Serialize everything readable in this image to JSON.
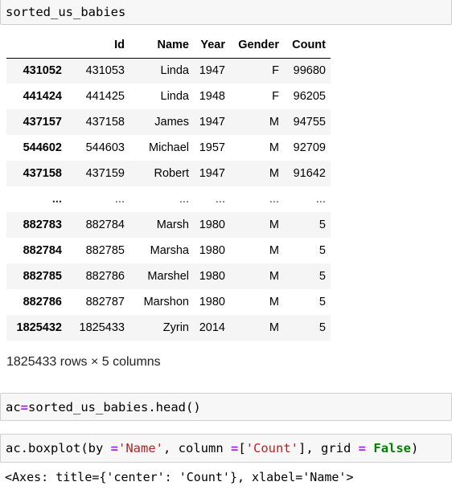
{
  "cells": {
    "cell1_code": "sorted_us_babies",
    "cell2": {
      "var": "ac",
      "op": "=",
      "rest": "sorted_us_babies.head()"
    },
    "cell3": {
      "p1": "ac.boxplot(by ",
      "eq1": "=",
      "s1": "'Name'",
      "p2": ", column ",
      "eq2": "=",
      "p3": "[",
      "s2": "'Count'",
      "p4": "], grid ",
      "eq3": "=",
      "p5": " ",
      "kw": "False",
      "p6": ")"
    },
    "output_repr": "<Axes: title={'center': 'Count'}, xlabel='Name'>"
  },
  "dataframe": {
    "columns": [
      "Id",
      "Name",
      "Year",
      "Gender",
      "Count"
    ],
    "rows": [
      {
        "index": "431052",
        "cells": [
          "431053",
          "Linda",
          "1947",
          "F",
          "99680"
        ]
      },
      {
        "index": "441424",
        "cells": [
          "441425",
          "Linda",
          "1948",
          "F",
          "96205"
        ]
      },
      {
        "index": "437157",
        "cells": [
          "437158",
          "James",
          "1947",
          "M",
          "94755"
        ]
      },
      {
        "index": "544602",
        "cells": [
          "544603",
          "Michael",
          "1957",
          "M",
          "92709"
        ]
      },
      {
        "index": "437158",
        "cells": [
          "437159",
          "Robert",
          "1947",
          "M",
          "91642"
        ]
      },
      {
        "index": "...",
        "cells": [
          "...",
          "...",
          "...",
          "...",
          "..."
        ]
      },
      {
        "index": "882783",
        "cells": [
          "882784",
          "Marsh",
          "1980",
          "M",
          "5"
        ]
      },
      {
        "index": "882784",
        "cells": [
          "882785",
          "Marsha",
          "1980",
          "M",
          "5"
        ]
      },
      {
        "index": "882785",
        "cells": [
          "882786",
          "Marshel",
          "1980",
          "M",
          "5"
        ]
      },
      {
        "index": "882786",
        "cells": [
          "882787",
          "Marshon",
          "1980",
          "M",
          "5"
        ]
      },
      {
        "index": "1825432",
        "cells": [
          "1825433",
          "Zyrin",
          "2014",
          "M",
          "5"
        ]
      }
    ],
    "shape_text": "1825433 rows × 5 columns"
  }
}
